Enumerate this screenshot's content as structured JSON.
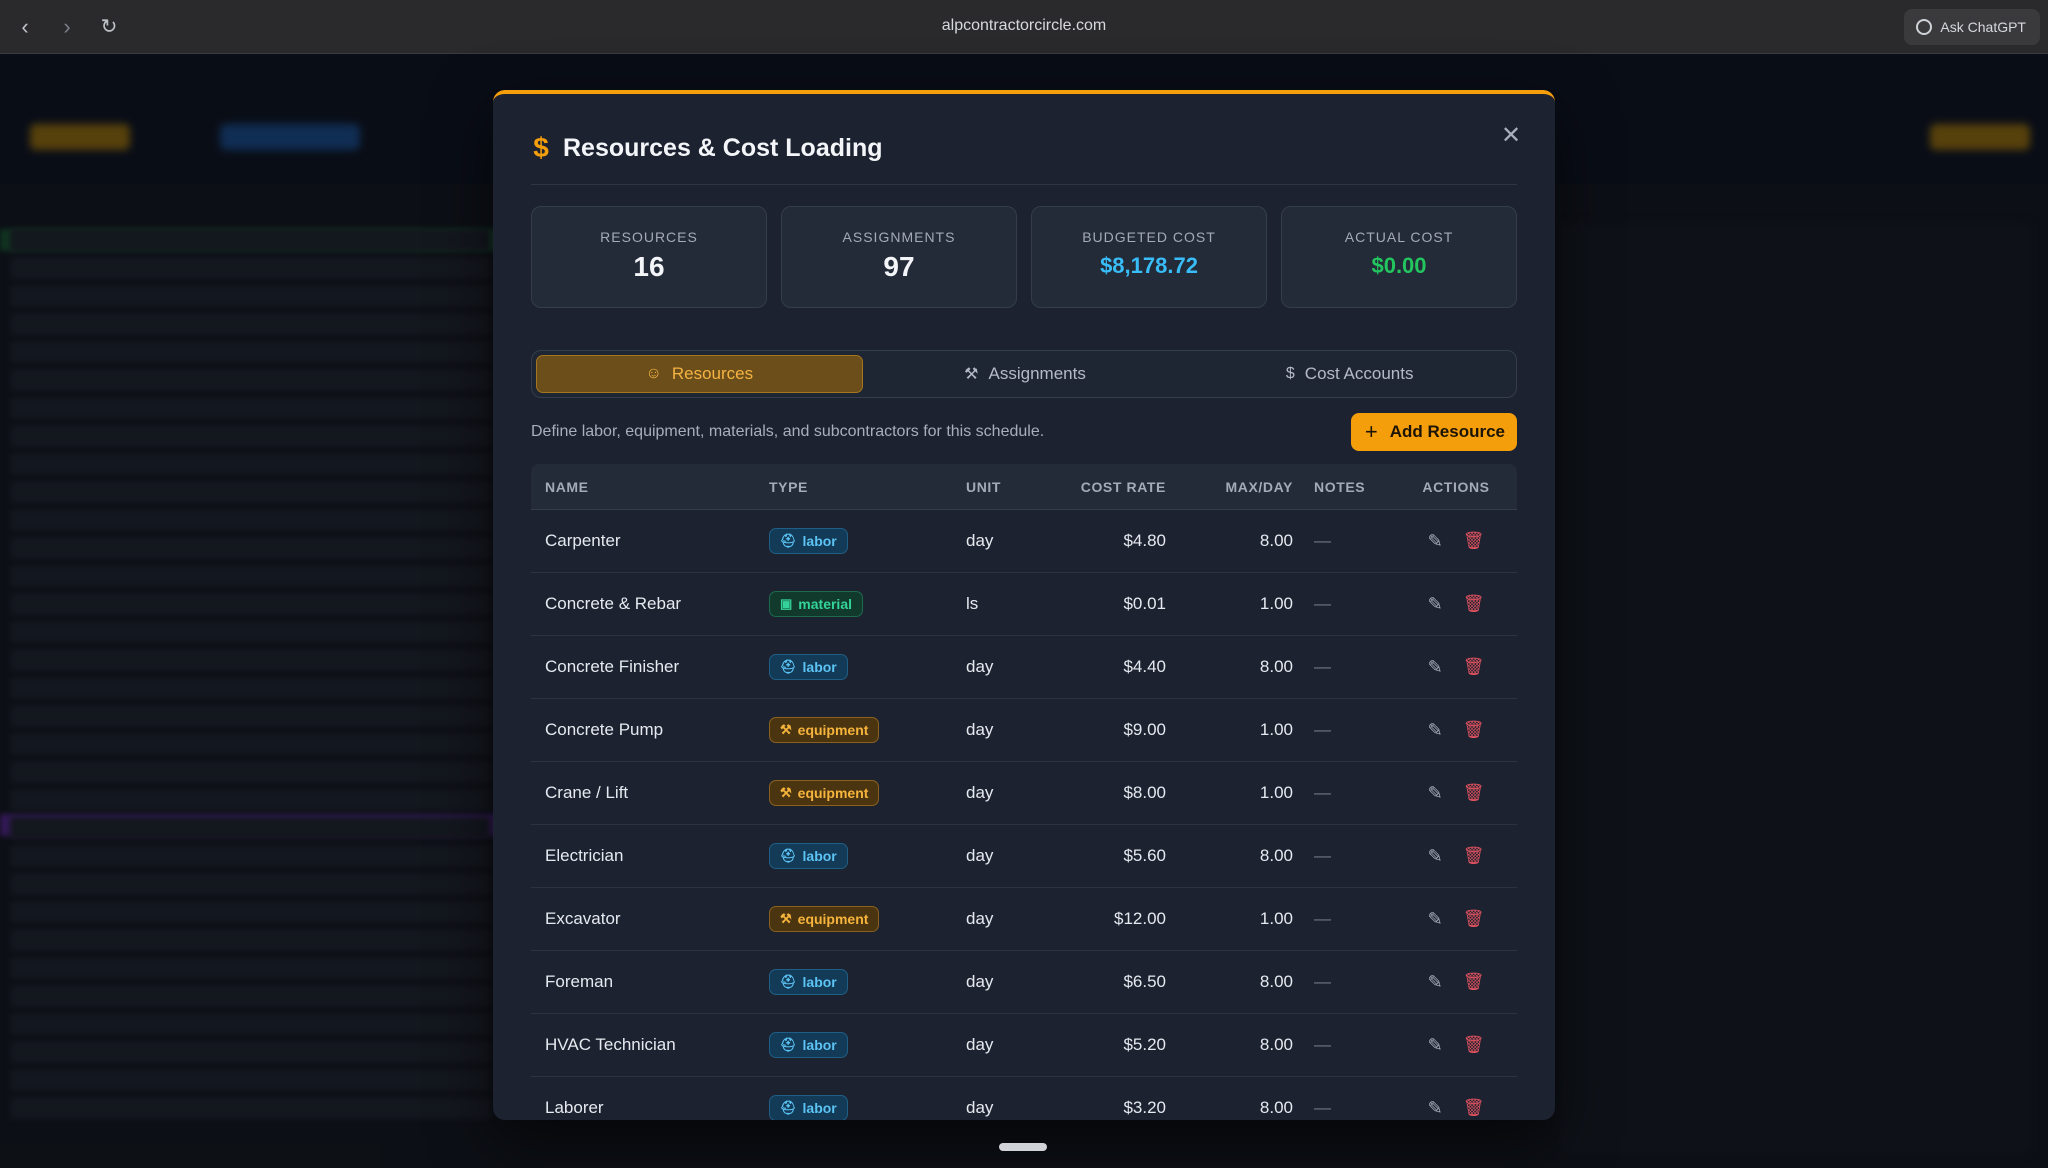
{
  "browser": {
    "url": "alpcontractorcircle.com",
    "ask_label": "Ask ChatGPT",
    "back_icon": "chevron-left-icon",
    "forward_icon": "chevron-right-icon",
    "reload_icon": "reload-icon"
  },
  "modal": {
    "title": "Resources & Cost Loading",
    "accent_color": "#f59e0b",
    "close_icon": "close-icon",
    "stats": [
      {
        "label": "RESOURCES",
        "value": "16"
      },
      {
        "label": "ASSIGNMENTS",
        "value": "97"
      },
      {
        "label": "BUDGETED COST",
        "value": "$8,178.72"
      },
      {
        "label": "ACTUAL COST",
        "value": "$0.00"
      }
    ],
    "tabs": [
      {
        "label": "Resources",
        "icon": "users-icon",
        "active": true
      },
      {
        "label": "Assignments",
        "icon": "wrench-icon",
        "active": false
      },
      {
        "label": "Cost Accounts",
        "icon": "dollar-icon",
        "active": false
      }
    ],
    "description": "Define labor, equipment, materials, and subcontractors for this schedule.",
    "add_button": "Add Resource",
    "table": {
      "columns": [
        "NAME",
        "TYPE",
        "UNIT",
        "COST RATE",
        "MAX/DAY",
        "NOTES",
        "ACTIONS"
      ],
      "rows": [
        {
          "name": "Carpenter",
          "type": "labor",
          "unit": "day",
          "rate": "$4.80",
          "max": "8.00",
          "notes": "—"
        },
        {
          "name": "Concrete & Rebar",
          "type": "material",
          "unit": "ls",
          "rate": "$0.01",
          "max": "1.00",
          "notes": "—"
        },
        {
          "name": "Concrete Finisher",
          "type": "labor",
          "unit": "day",
          "rate": "$4.40",
          "max": "8.00",
          "notes": "—"
        },
        {
          "name": "Concrete Pump",
          "type": "equipment",
          "unit": "day",
          "rate": "$9.00",
          "max": "1.00",
          "notes": "—"
        },
        {
          "name": "Crane / Lift",
          "type": "equipment",
          "unit": "day",
          "rate": "$8.00",
          "max": "1.00",
          "notes": "—"
        },
        {
          "name": "Electrician",
          "type": "labor",
          "unit": "day",
          "rate": "$5.60",
          "max": "8.00",
          "notes": "—"
        },
        {
          "name": "Excavator",
          "type": "equipment",
          "unit": "day",
          "rate": "$12.00",
          "max": "1.00",
          "notes": "—"
        },
        {
          "name": "Foreman",
          "type": "labor",
          "unit": "day",
          "rate": "$6.50",
          "max": "8.00",
          "notes": "—"
        },
        {
          "name": "HVAC Technician",
          "type": "labor",
          "unit": "day",
          "rate": "$5.20",
          "max": "8.00",
          "notes": "—"
        },
        {
          "name": "Laborer",
          "type": "labor",
          "unit": "day",
          "rate": "$3.20",
          "max": "8.00",
          "notes": "—"
        }
      ]
    }
  }
}
